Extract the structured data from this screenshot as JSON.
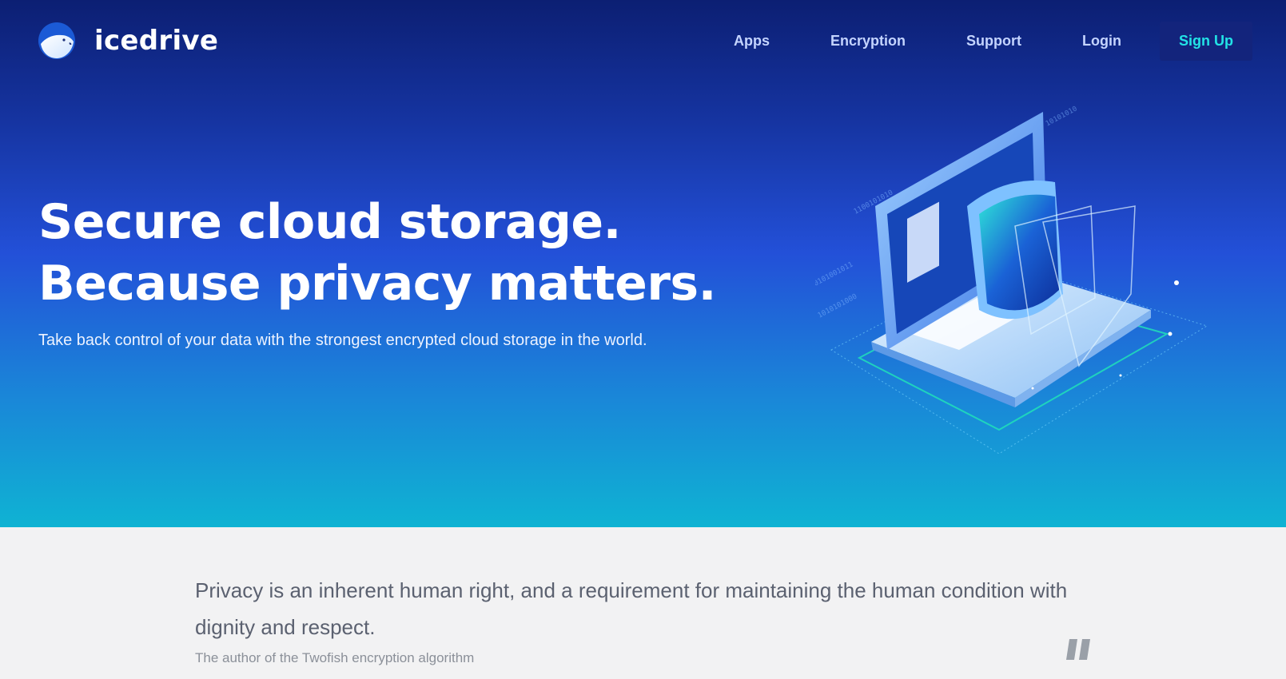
{
  "brand": {
    "name": "icedrive",
    "logo_icon": "polar-bear-logo-icon"
  },
  "nav": {
    "items": [
      "Apps",
      "Encryption",
      "Support",
      "Login"
    ],
    "signup_label": "Sign Up"
  },
  "hero": {
    "headline_line1": "Secure cloud storage.",
    "headline_line2": "Because privacy matters.",
    "subhead": "Take back control of your data with the strongest encrypted cloud storage in the world.",
    "illustration_icon": "laptop-shield-icon"
  },
  "quote": {
    "text": "Privacy is an inherent human right, and a requirement for maintaining the human condition with dignity and respect.",
    "author": "The author of the Twofish encryption algorithm",
    "icon": "quote-mark-icon"
  },
  "colors": {
    "accent": "#22e3e6",
    "hero_top": "#0c1f73",
    "hero_bottom": "#0fb3d3",
    "page_bg": "#f2f2f3"
  }
}
